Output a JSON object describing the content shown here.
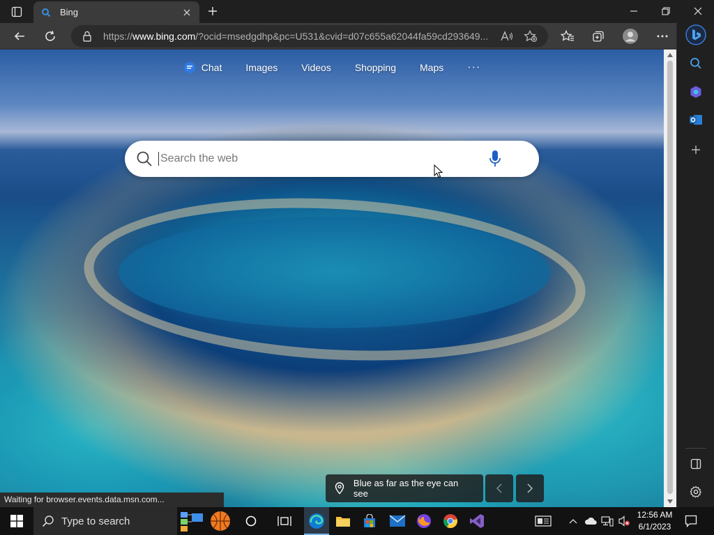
{
  "tab": {
    "title": "Bing"
  },
  "address": {
    "url_prefix": "https://",
    "url_domain": "www.bing.com",
    "url_rest": "/?ocid=msedgdhp&pc=U531&cvid=d07c655a62044fa59cd293649..."
  },
  "nav": {
    "chat": "Chat",
    "images": "Images",
    "videos": "Videos",
    "shopping": "Shopping",
    "maps": "Maps",
    "more": "···"
  },
  "search": {
    "placeholder": "Search the web"
  },
  "caption": {
    "text": "Blue as far as the eye can see"
  },
  "status": {
    "text": "Waiting for browser.events.data.msn.com..."
  },
  "taskbar": {
    "search_placeholder": "Type to search",
    "time": "12:56 AM",
    "date": "6/1/2023"
  },
  "colors": {
    "accent": "#76b9ed",
    "tab_bg": "#3b3b3b",
    "chrome_bg": "#1f1f1f"
  }
}
